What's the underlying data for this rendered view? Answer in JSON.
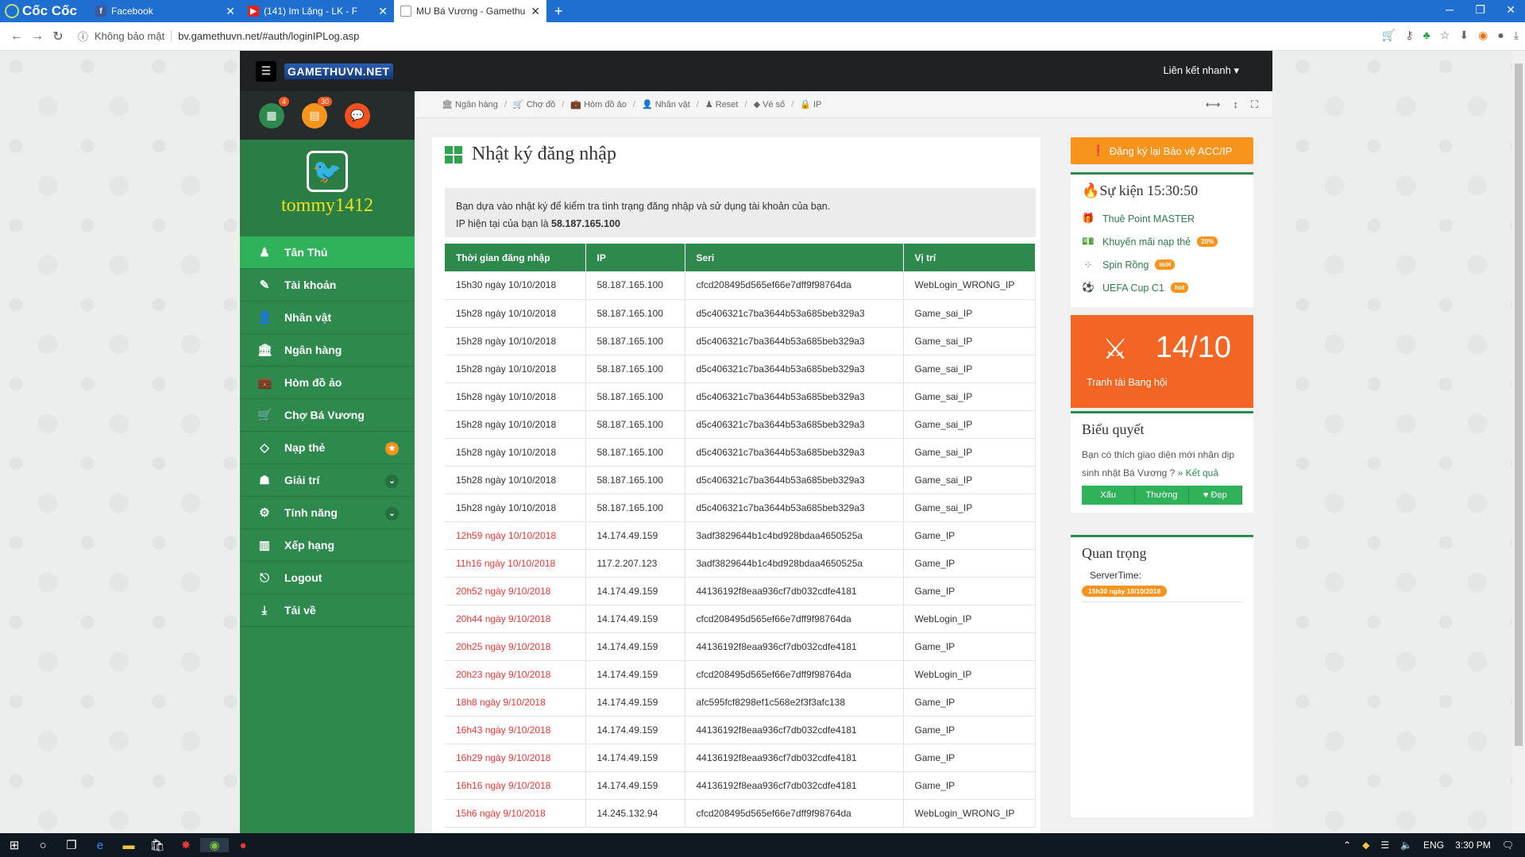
{
  "browser": {
    "brand": "Cốc Cốc",
    "tabs": [
      {
        "title": "Facebook",
        "icon": "facebook-icon"
      },
      {
        "title": "(141) Im Lặng - LK - F",
        "icon": "youtube-icon"
      },
      {
        "title": "MU Bá Vương - Gamethu",
        "icon": "page-icon"
      }
    ],
    "security": "Không bảo mật",
    "url": "bv.gamethuvn.net/#auth/loginIPLog.asp"
  },
  "site": {
    "logo": "GAMETHUVN.NET",
    "quicklink": "Liên kết nhanh",
    "username": "tommy1412",
    "badges": {
      "calendar": "4",
      "card": "30"
    },
    "sidebar": [
      {
        "label": "Tân Thủ",
        "icon": "person-icon"
      },
      {
        "label": "Tài khoản",
        "icon": "edit-icon"
      },
      {
        "label": "Nhân vật",
        "icon": "user-icon"
      },
      {
        "label": "Ngân hàng",
        "icon": "bank-icon"
      },
      {
        "label": "Hòm đồ ảo",
        "icon": "briefcase-icon"
      },
      {
        "label": "Chợ Bá Vương",
        "icon": "cart-icon"
      },
      {
        "label": "Nạp thẻ",
        "icon": "diamond-icon"
      },
      {
        "label": "Giải trí",
        "icon": "android-icon"
      },
      {
        "label": "Tính năng",
        "icon": "cogs-icon"
      },
      {
        "label": "Xếp hạng",
        "icon": "chart-icon"
      },
      {
        "label": "Logout",
        "icon": "logout-icon"
      },
      {
        "label": "Tải về",
        "icon": "download-icon"
      }
    ],
    "breadcrumb": [
      "Ngân hàng",
      "Chợ đồ",
      "Hòm đồ ảo",
      "Nhân vật",
      "Reset",
      "Vé số",
      "IP"
    ]
  },
  "main": {
    "title": "Nhật ký đăng nhập",
    "info_line1": "Bạn dựa vào nhật ký để kiểm tra tình trạng đăng nhập và sử dụng tài khoản của bạn.",
    "info_line2_prefix": "IP hiện tại của bạn là ",
    "current_ip": "58.187.165.100",
    "columns": [
      "Thời gian đăng nhập",
      "IP",
      "Seri",
      "Vị trí"
    ],
    "rows": [
      {
        "time": "15h30 ngày 10/10/2018",
        "ip": "58.187.165.100",
        "seri": "cfcd208495d565ef66e7dff9f98764da",
        "pos": "WebLogin_WRONG_IP",
        "red": false
      },
      {
        "time": "15h28 ngày 10/10/2018",
        "ip": "58.187.165.100",
        "seri": "d5c406321c7ba3644b53a685beb329a3",
        "pos": "Game_sai_IP",
        "red": false
      },
      {
        "time": "15h28 ngày 10/10/2018",
        "ip": "58.187.165.100",
        "seri": "d5c406321c7ba3644b53a685beb329a3",
        "pos": "Game_sai_IP",
        "red": false
      },
      {
        "time": "15h28 ngày 10/10/2018",
        "ip": "58.187.165.100",
        "seri": "d5c406321c7ba3644b53a685beb329a3",
        "pos": "Game_sai_IP",
        "red": false
      },
      {
        "time": "15h28 ngày 10/10/2018",
        "ip": "58.187.165.100",
        "seri": "d5c406321c7ba3644b53a685beb329a3",
        "pos": "Game_sai_IP",
        "red": false
      },
      {
        "time": "15h28 ngày 10/10/2018",
        "ip": "58.187.165.100",
        "seri": "d5c406321c7ba3644b53a685beb329a3",
        "pos": "Game_sai_IP",
        "red": false
      },
      {
        "time": "15h28 ngày 10/10/2018",
        "ip": "58.187.165.100",
        "seri": "d5c406321c7ba3644b53a685beb329a3",
        "pos": "Game_sai_IP",
        "red": false
      },
      {
        "time": "15h28 ngày 10/10/2018",
        "ip": "58.187.165.100",
        "seri": "d5c406321c7ba3644b53a685beb329a3",
        "pos": "Game_sai_IP",
        "red": false
      },
      {
        "time": "15h28 ngày 10/10/2018",
        "ip": "58.187.165.100",
        "seri": "d5c406321c7ba3644b53a685beb329a3",
        "pos": "Game_sai_IP",
        "red": false
      },
      {
        "time": "12h59 ngày 10/10/2018",
        "ip": "14.174.49.159",
        "seri": "3adf3829644b1c4bd928bdaa4650525a",
        "pos": "Game_IP",
        "red": true
      },
      {
        "time": "11h16 ngày 10/10/2018",
        "ip": "117.2.207.123",
        "seri": "3adf3829644b1c4bd928bdaa4650525a",
        "pos": "Game_IP",
        "red": true
      },
      {
        "time": "20h52 ngày 9/10/2018",
        "ip": "14.174.49.159",
        "seri": "44136192f8eaa936cf7db032cdfe4181",
        "pos": "Game_IP",
        "red": true
      },
      {
        "time": "20h44 ngày 9/10/2018",
        "ip": "14.174.49.159",
        "seri": "cfcd208495d565ef66e7dff9f98764da",
        "pos": "WebLogin_IP",
        "red": true
      },
      {
        "time": "20h25 ngày 9/10/2018",
        "ip": "14.174.49.159",
        "seri": "44136192f8eaa936cf7db032cdfe4181",
        "pos": "Game_IP",
        "red": true
      },
      {
        "time": "20h23 ngày 9/10/2018",
        "ip": "14.174.49.159",
        "seri": "cfcd208495d565ef66e7dff9f98764da",
        "pos": "WebLogin_IP",
        "red": true
      },
      {
        "time": "18h8 ngày 9/10/2018",
        "ip": "14.174.49.159",
        "seri": "afc595fcf8298ef1c568e2f3f3afc138",
        "pos": "Game_IP",
        "red": true
      },
      {
        "time": "16h43 ngày 9/10/2018",
        "ip": "14.174.49.159",
        "seri": "44136192f8eaa936cf7db032cdfe4181",
        "pos": "Game_IP",
        "red": true
      },
      {
        "time": "16h29 ngày 9/10/2018",
        "ip": "14.174.49.159",
        "seri": "44136192f8eaa936cf7db032cdfe4181",
        "pos": "Game_IP",
        "red": true
      },
      {
        "time": "16h16 ngày 9/10/2018",
        "ip": "14.174.49.159",
        "seri": "44136192f8eaa936cf7db032cdfe4181",
        "pos": "Game_IP",
        "red": true
      },
      {
        "time": "15h6 ngày 9/10/2018",
        "ip": "14.245.132.94",
        "seri": "cfcd208495d565ef66e7dff9f98764da",
        "pos": "WebLogin_WRONG_IP",
        "red": true
      }
    ]
  },
  "right": {
    "reg_button": "Đăng ký lại Bảo vệ ACC/IP",
    "events_title": "Sự kiện 15:30:50",
    "events": [
      {
        "label": "Thuê Point MASTER",
        "tag": ""
      },
      {
        "label": "Khuyến mãi nạp thẻ",
        "tag": "20%"
      },
      {
        "label": "Spin Rồng",
        "tag": "mới"
      },
      {
        "label": "UEFA Cup C1",
        "tag": "hot"
      }
    ],
    "guild_date": "14/10",
    "guild_label": "Tranh tài Bang hội",
    "poll_title": "Biểu quyết",
    "poll_text": "Bạn có thích giao diện mới nhân dịp sinh nhật Bá Vương ? ",
    "poll_link": "» Kết quả",
    "poll_options": [
      "Xấu",
      "Thường",
      "♥ Đẹp"
    ],
    "important_title": "Quan trọng",
    "server_label": "ServerTime:",
    "server_time": "15h30 ngày 10/10/2018"
  },
  "taskbar": {
    "lang": "ENG",
    "time": "3:30 PM"
  },
  "colors": {
    "primary_green": "#2e8a4c",
    "orange": "#f7941d",
    "red_time": "#e53935"
  }
}
